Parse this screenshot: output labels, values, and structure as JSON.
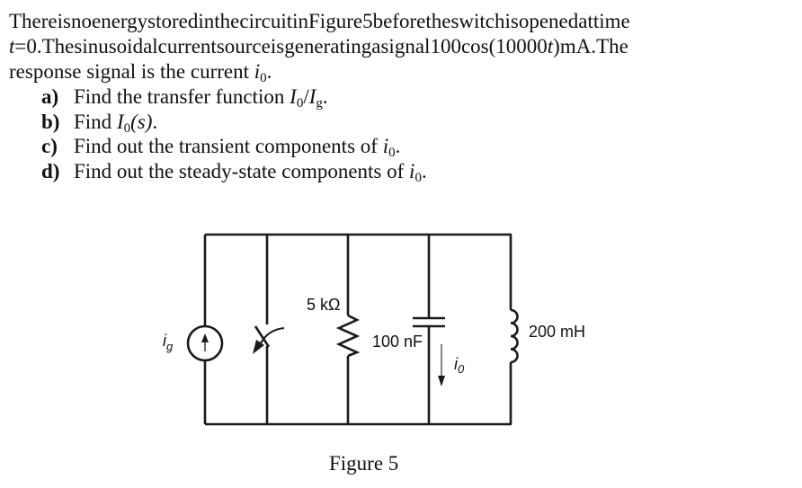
{
  "problem": {
    "line1_words": [
      "There",
      "is",
      "no",
      "energy",
      "stored",
      "in",
      "the",
      "circuit",
      "in",
      "Figure",
      "5",
      "before",
      "the",
      "switch",
      "is",
      "opened",
      "at",
      "time"
    ],
    "line2_prefix_var": "t",
    "line2_words": [
      "=0.",
      "The",
      "sinusoidal",
      "current",
      "source",
      "is",
      "generating",
      "a",
      "signal"
    ],
    "signal_prefix": "100cos(10000",
    "signal_var": "t",
    "signal_suffix": ")",
    "signal_unit": "mA.",
    "line2_end": "The",
    "line3_text": "response signal is the current ",
    "response_var": "i",
    "response_sub": "0",
    "line3_end": "."
  },
  "questions": [
    {
      "label": "a)",
      "text": "Find the transfer function ",
      "math": {
        "a": "I",
        "a_sub": "0",
        "sep": "/",
        "b": "I",
        "b_sub": "g"
      },
      "end": "."
    },
    {
      "label": "b)",
      "text": "Find ",
      "math": {
        "a": "I",
        "a_sub": "0",
        "paren": "(s)"
      },
      "end": "."
    },
    {
      "label": "c)",
      "text": "Find out the transient components of ",
      "math": {
        "a": "i",
        "a_sub": "0"
      },
      "end": "."
    },
    {
      "label": "d)",
      "text": "Find out the steady-state components of ",
      "math": {
        "a": "i",
        "a_sub": "0"
      },
      "end": "."
    }
  ],
  "circuit": {
    "source_label": "i",
    "source_label_sub": "g",
    "resistor_label": "5 kΩ",
    "capacitor_label": "100 nF",
    "inductor_label": "200 mH",
    "current_label": "i",
    "current_label_sub": "0",
    "components": [
      "current-source",
      "switch",
      "resistor",
      "capacitor",
      "inductor"
    ],
    "stroke_color": "#1a1a1a",
    "current_arrow_color": "#333333"
  },
  "figure_caption": "Figure 5"
}
